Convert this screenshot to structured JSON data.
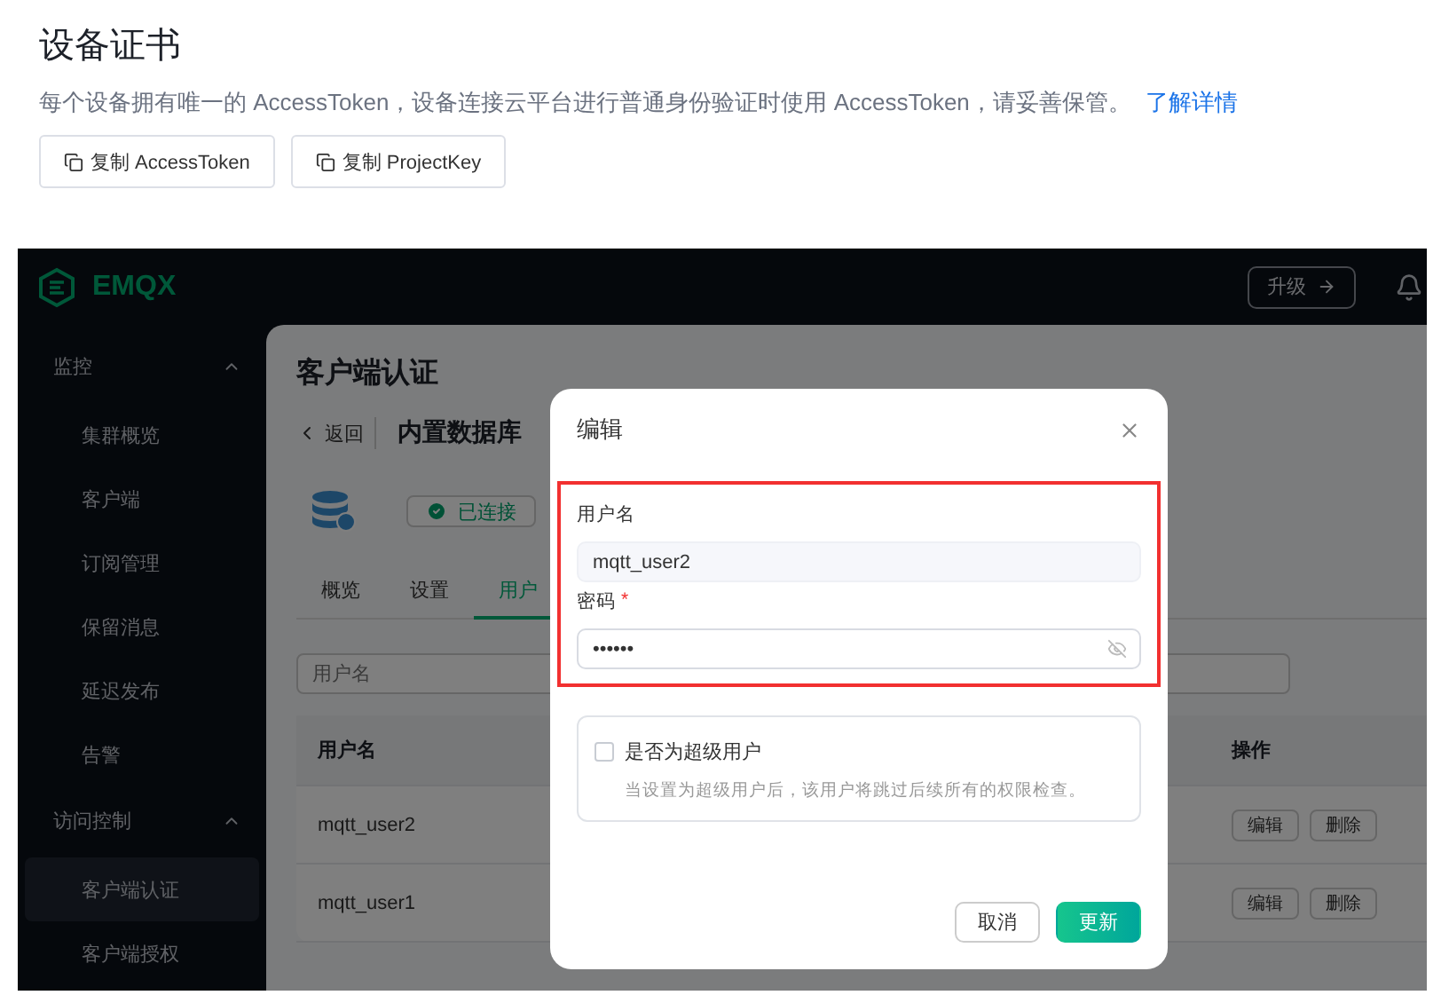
{
  "page": {
    "title": "设备证书",
    "description": "每个设备拥有唯一的 AccessToken，设备连接云平台进行普通身份验证时使用 AccessToken，请妥善保管。",
    "link": "了解详情",
    "buttons": [
      "复制 AccessToken",
      "复制 ProjectKey"
    ]
  },
  "app": {
    "logo": "EMQX",
    "upgrade_button": "升级",
    "sidebar": [
      {
        "label": "监控",
        "expanded": true,
        "items": [
          {
            "label": "集群概览",
            "selected": false
          },
          {
            "label": "客户端",
            "selected": false
          },
          {
            "label": "订阅管理",
            "selected": false
          },
          {
            "label": "保留消息",
            "selected": false
          },
          {
            "label": "延迟发布",
            "selected": false
          },
          {
            "label": "告警",
            "selected": false
          }
        ]
      },
      {
        "label": "访问控制",
        "expanded": true,
        "items": [
          {
            "label": "客户端认证",
            "selected": true
          },
          {
            "label": "客户端授权",
            "selected": false
          }
        ]
      }
    ],
    "main": {
      "title": "客户端认证",
      "back": "返回",
      "source": "内置数据库",
      "status": "已连接",
      "tabs": [
        {
          "label": "概览",
          "selected": false
        },
        {
          "label": "设置",
          "selected": false
        },
        {
          "label": "用户",
          "selected": true
        }
      ],
      "search_placeholder": "用户名",
      "table": {
        "columns": [
          "用户名",
          "操作"
        ],
        "rows": [
          {
            "username": "mqtt_user2",
            "actions": [
              "编辑",
              "删除"
            ]
          },
          {
            "username": "mqtt_user1",
            "actions": [
              "编辑",
              "删除"
            ]
          }
        ]
      }
    }
  },
  "dialog": {
    "title": "编辑",
    "fields": [
      {
        "kind": "text",
        "label": "用户名",
        "value": "mqtt_user2"
      },
      {
        "kind": "password",
        "label": "密码",
        "required_mark": "*",
        "value": "••••••"
      }
    ],
    "superuser": {
      "label": "是否为超级用户",
      "checked": false,
      "help": "当设置为超级用户后，该用户将跳过后续所有的权限检查。"
    },
    "buttons": [
      {
        "label": "取消",
        "primary": false
      },
      {
        "label": "更新",
        "primary": true
      }
    ]
  }
}
